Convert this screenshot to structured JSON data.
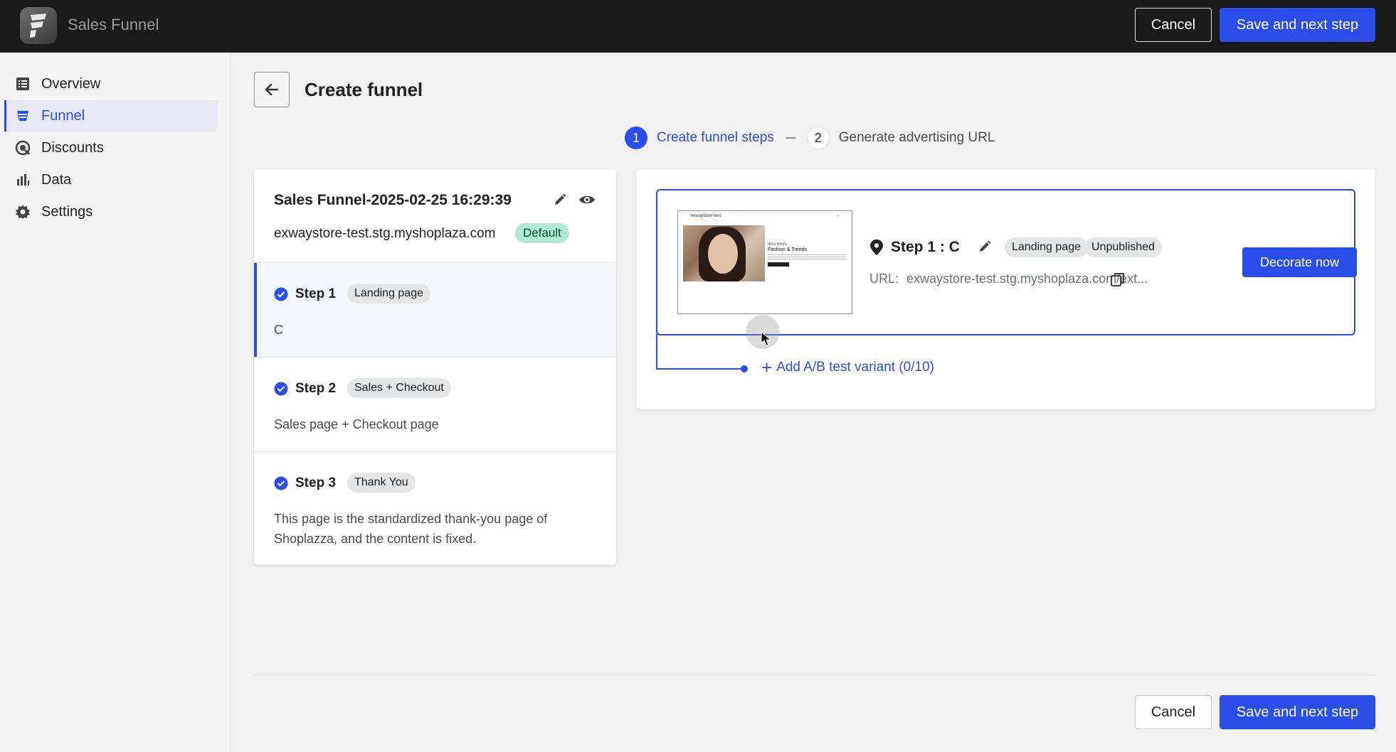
{
  "app": {
    "title": "Sales Funnel"
  },
  "topbar": {
    "cancel_label": "Cancel",
    "save_label": "Save and next step"
  },
  "sidebar": {
    "items": [
      {
        "label": "Overview",
        "icon": "list-icon",
        "active": false
      },
      {
        "label": "Funnel",
        "icon": "funnel-icon",
        "active": true
      },
      {
        "label": "Discounts",
        "icon": "discount-icon",
        "active": false
      },
      {
        "label": "Data",
        "icon": "bar-chart-icon",
        "active": false
      },
      {
        "label": "Settings",
        "icon": "gear-icon",
        "active": false
      }
    ]
  },
  "page": {
    "title": "Create funnel"
  },
  "progress": {
    "steps": [
      {
        "number": "1",
        "label": "Create funnel steps",
        "active": true
      },
      {
        "number": "2",
        "label": "Generate advertising URL",
        "active": false
      }
    ]
  },
  "funnel": {
    "name": "Sales Funnel-2025-02-25 16:29:39",
    "domain": "exwaystore-test.stg.myshoplaza.com",
    "domain_badge": "Default",
    "steps": [
      {
        "title": "Step 1",
        "tag": "Landing page",
        "description": "C"
      },
      {
        "title": "Step 2",
        "tag": "Sales + Checkout",
        "description": "Sales page + Checkout page"
      },
      {
        "title": "Step 3",
        "tag": "Thank You",
        "description": "This page is the standardized thank-you page of Shoplazza, and the content is fixed."
      }
    ]
  },
  "variant": {
    "title": "Step 1 :  C",
    "tags": [
      "Landing page",
      "Unpublished"
    ],
    "url_label": "URL:",
    "url_value": "exwaystore-test.stg.myshoplaza.com/ext...",
    "decorate_label": "Decorate now",
    "thumbnail": {
      "store_name": "exwaystore-test",
      "small_text": "Write Who's",
      "headline": "Fashion & Trends"
    }
  },
  "ab_test": {
    "label": "Add A/B test variant (0/10)"
  },
  "footer": {
    "cancel_label": "Cancel",
    "save_label": "Save and next step"
  },
  "colors": {
    "primary": "#2b4ee8",
    "topbar": "#1a1a1a",
    "default_badge": "#aee9d1"
  }
}
